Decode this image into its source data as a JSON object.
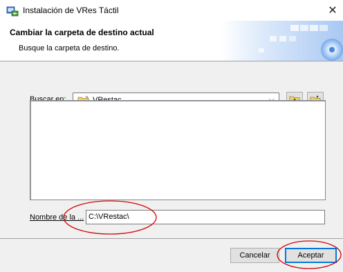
{
  "window": {
    "title": "Instalación de VRes Táctil",
    "close_symbol": "✕"
  },
  "banner": {
    "title": "Cambiar la carpeta de destino actual",
    "subtitle": "Busque la carpeta de destino."
  },
  "browse": {
    "lookin_label": "Buscar en:",
    "folder_name": "VRestac",
    "folder_icon": "folder-icon",
    "up_button_icon": "folder-up-icon",
    "new_folder_icon": "new-folder-icon"
  },
  "path": {
    "label": "Nombre de la ...",
    "value": "C:\\VRestac\\"
  },
  "buttons": {
    "cancel": "Cancelar",
    "ok": "Aceptar"
  },
  "colors": {
    "accent": "#0078d7",
    "annotation": "#d40000",
    "background": "#f0f0f0"
  }
}
